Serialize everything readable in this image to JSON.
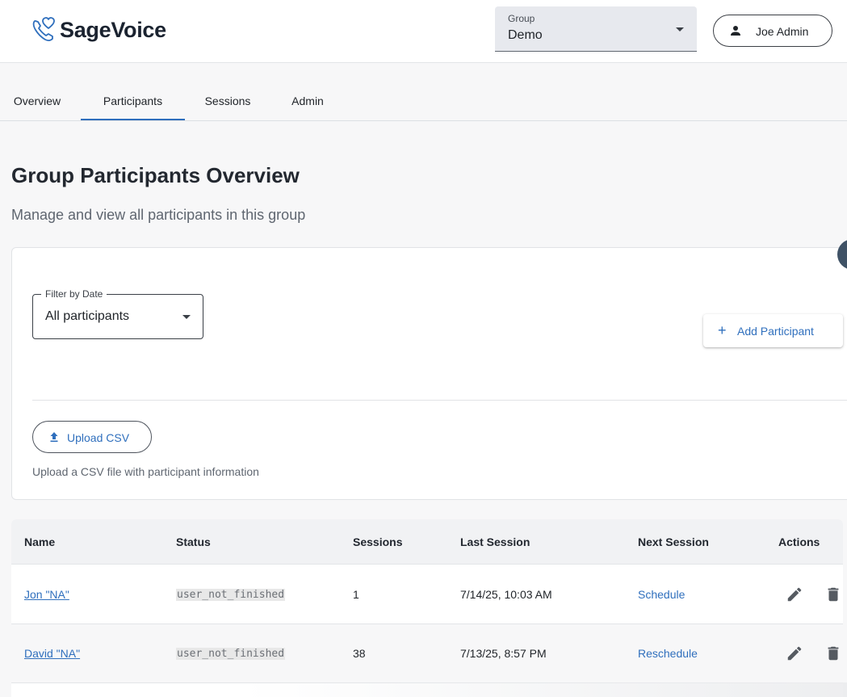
{
  "header": {
    "app_name": "SageVoice",
    "group_select": {
      "label": "Group",
      "value": "Demo"
    },
    "user_button": {
      "label": "Joe Admin"
    }
  },
  "tabs": [
    {
      "label": "Overview",
      "active": false
    },
    {
      "label": "Participants",
      "active": true
    },
    {
      "label": "Sessions",
      "active": false
    },
    {
      "label": "Admin",
      "active": false
    }
  ],
  "page": {
    "title": "Group Participants Overview",
    "subtitle": "Manage and view all participants in this group"
  },
  "controls": {
    "filter": {
      "label": "Filter by Date",
      "value": "All participants"
    },
    "add_participant_label": "Add Participant",
    "upload_label": "Upload CSV",
    "upload_help": "Upload a CSV file with participant information"
  },
  "table": {
    "headers": [
      "Name",
      "Status",
      "Sessions",
      "Last Session",
      "Next Session",
      "Actions"
    ],
    "rows": [
      {
        "name": "Jon \"NA\"",
        "status": "user_not_finished",
        "sessions": "1",
        "last_session": "7/14/25, 10:03 AM",
        "next_session": "Schedule"
      },
      {
        "name": "David \"NA\"",
        "status": "user_not_finished",
        "sessions": "38",
        "last_session": "7/13/25, 8:57 PM",
        "next_session": "Reschedule"
      }
    ]
  },
  "icons": {
    "logo": "phone-heart-icon",
    "user": "person-icon",
    "add": "plus-icon",
    "upload": "upload-icon",
    "edit": "pencil-icon",
    "delete": "trash-icon"
  },
  "colors": {
    "accent": "#2f6fbd",
    "logo_accent": "#2f6fbd",
    "text": "#1f2328",
    "muted": "#5f6670"
  }
}
